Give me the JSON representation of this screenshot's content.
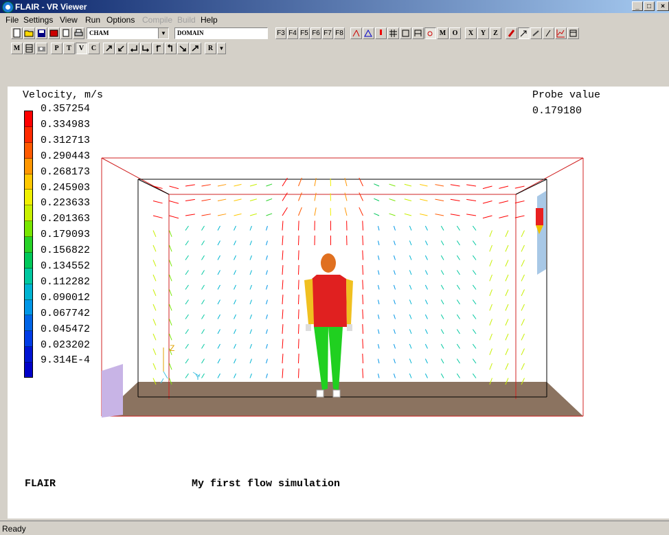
{
  "window": {
    "title": "FLAIR - VR Viewer"
  },
  "menu": [
    "File",
    "Settings",
    "View",
    "Run",
    "Options",
    "Compile",
    "Build",
    "Help"
  ],
  "menu_disabled": [
    "Compile",
    "Build"
  ],
  "toolbar": {
    "combo1": "CHAM",
    "combo2": "DOMAIN",
    "fkeys": [
      "F3",
      "F4",
      "F5",
      "F6",
      "F7",
      "F8"
    ],
    "letters_row1": [
      "M",
      "O",
      "X",
      "Y",
      "Z"
    ],
    "letters_row2": [
      "M",
      "P",
      "T",
      "V",
      "C",
      "R"
    ]
  },
  "viewport": {
    "legend_title": "Velocity, m/s",
    "legend_values": [
      "0.357254",
      "0.334983",
      "0.312713",
      "0.290443",
      "0.268173",
      "0.245903",
      "0.223633",
      "0.201363",
      "0.179093",
      "0.156822",
      "0.134552",
      "0.112282",
      "0.090012",
      "0.067742",
      "0.045472",
      "0.023202",
      "9.314E-4"
    ],
    "legend_colors": [
      "#ff0000",
      "#ff2a00",
      "#ff5a00",
      "#ff9600",
      "#ffc800",
      "#f0f000",
      "#c8f000",
      "#78e600",
      "#28d228",
      "#00c85a",
      "#00c8a0",
      "#00b4d2",
      "#0096e6",
      "#0064e6",
      "#003ce6",
      "#0014d2",
      "#0000c8"
    ],
    "probe_label": "Probe value",
    "probe_value": "0.179180",
    "caption_left": "FLAIR",
    "caption_center": "My first flow simulation"
  },
  "status": {
    "text": "Ready"
  },
  "axes_labels": {
    "z": "Z",
    "y": "Y"
  }
}
